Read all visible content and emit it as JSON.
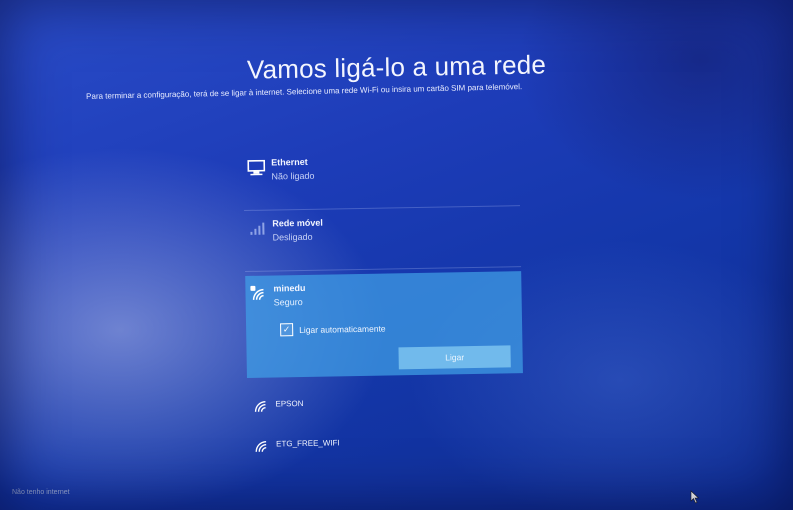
{
  "title": "Vamos ligá-lo a uma rede",
  "subtitle": "Para terminar a configuração, terá de se ligar à internet. Selecione uma rede Wi-Fi ou insira um cartão SIM para telemóvel.",
  "networks": [
    {
      "name": "Ethernet",
      "status": "Não ligado",
      "icon": "ethernet-icon"
    },
    {
      "name": "Rede móvel",
      "status": "Desligado",
      "icon": "cellular-icon"
    },
    {
      "name": "minedu",
      "status": "Seguro",
      "icon": "wifi-secure-icon",
      "selected": true,
      "auto_connect_label": "Ligar automaticamente",
      "auto_connect_checked": true,
      "connect_label": "Ligar"
    },
    {
      "name": "EPSON",
      "icon": "wifi-icon"
    },
    {
      "name": "ETG_FREE_WIFI",
      "icon": "wifi-icon"
    }
  ],
  "bottom_status": "Não tenho internet",
  "colors": {
    "background": "#1d3cb8",
    "selected": "#40a0e6"
  }
}
